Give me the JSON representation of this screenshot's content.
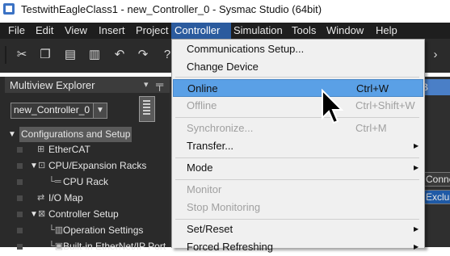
{
  "window": {
    "title": "TestwithEagleClass1 - new_Controller_0 - Sysmac Studio (64bit)"
  },
  "menubar": {
    "items": [
      {
        "label": "File"
      },
      {
        "label": "Edit"
      },
      {
        "label": "View"
      },
      {
        "label": "Insert"
      },
      {
        "label": "Project"
      },
      {
        "label": "Controller"
      },
      {
        "label": "Simulation"
      },
      {
        "label": "Tools"
      },
      {
        "label": "Window"
      },
      {
        "label": "Help"
      }
    ],
    "active": "Controller"
  },
  "toolbar": {
    "icons": [
      "cut-icon",
      "copy-icon",
      "paste-icon",
      "delete-icon",
      "undo-icon",
      "redo-icon",
      "help-icon"
    ]
  },
  "explorer": {
    "title": "Multiview Explorer",
    "controller_select": {
      "value": "new_Controller_0"
    },
    "tree": [
      {
        "label": "Configurations and Setup",
        "selected": true
      },
      {
        "label": "EtherCAT"
      },
      {
        "label": "CPU/Expansion Racks"
      },
      {
        "label": "CPU Rack"
      },
      {
        "label": "I/O Map"
      },
      {
        "label": "Controller Setup"
      },
      {
        "label": "Operation Settings"
      },
      {
        "label": "Built-in EtherNet/IP Port"
      }
    ]
  },
  "right_panel": {
    "tab_label": "B",
    "cells": [
      "Conne",
      "Exclusiv"
    ]
  },
  "controller_menu": {
    "items": [
      {
        "label": "Communications Setup...",
        "shortcut": "",
        "enabled": true,
        "submenu": false
      },
      {
        "label": "Change Device",
        "shortcut": "",
        "enabled": true,
        "submenu": false
      },
      {
        "label": "Online",
        "shortcut": "Ctrl+W",
        "enabled": true,
        "submenu": false,
        "highlighted": true
      },
      {
        "label": "Offline",
        "shortcut": "Ctrl+Shift+W",
        "enabled": false,
        "submenu": false
      },
      {
        "label": "Synchronize...",
        "shortcut": "Ctrl+M",
        "enabled": false,
        "submenu": false
      },
      {
        "label": "Transfer...",
        "shortcut": "",
        "enabled": true,
        "submenu": true
      },
      {
        "label": "Mode",
        "shortcut": "",
        "enabled": true,
        "submenu": true
      },
      {
        "label": "Monitor",
        "shortcut": "",
        "enabled": false,
        "submenu": false
      },
      {
        "label": "Stop Monitoring",
        "shortcut": "",
        "enabled": false,
        "submenu": false
      },
      {
        "label": "Set/Reset",
        "shortcut": "",
        "enabled": true,
        "submenu": true
      },
      {
        "label": "Forced Refreshing",
        "shortcut": "",
        "enabled": true,
        "submenu": true
      }
    ]
  },
  "colors": {
    "menu_highlight": "#5aa0e6",
    "active_menu": "#2b5b9e",
    "dark_bg": "#2a2a2a"
  }
}
